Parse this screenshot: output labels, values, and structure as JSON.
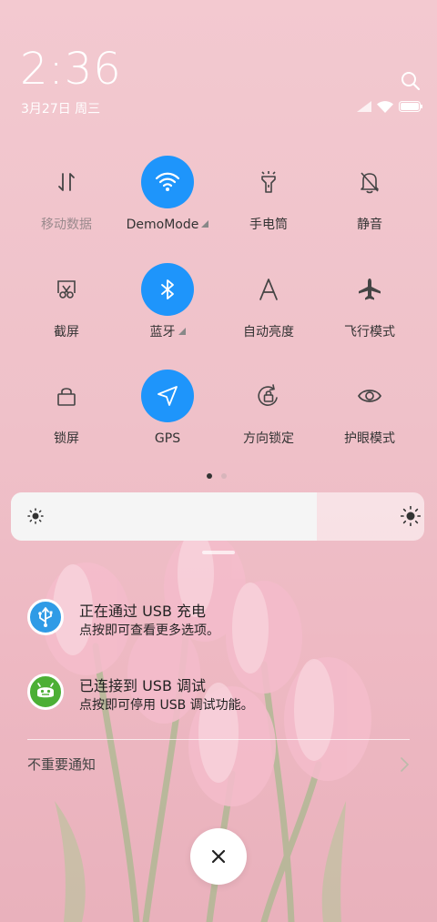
{
  "status": {
    "time": "2:36",
    "date": "3月27日 周三"
  },
  "quick_settings": {
    "row1": [
      {
        "label": "移动数据",
        "icon": "mobile-data-icon",
        "active": false
      },
      {
        "label": "DemoMode",
        "icon": "wifi-icon",
        "active": true
      },
      {
        "label": "手电筒",
        "icon": "flashlight-icon",
        "active": false
      },
      {
        "label": "静音",
        "icon": "mute-bell-icon",
        "active": false
      }
    ],
    "row2": [
      {
        "label": "截屏",
        "icon": "screenshot-icon",
        "active": false
      },
      {
        "label": "蓝牙",
        "icon": "bluetooth-icon",
        "active": true
      },
      {
        "label": "自动亮度",
        "icon": "auto-brightness-icon",
        "active": false
      },
      {
        "label": "飞行模式",
        "icon": "airplane-icon",
        "active": false
      }
    ],
    "row3": [
      {
        "label": "锁屏",
        "icon": "lock-icon",
        "active": false
      },
      {
        "label": "GPS",
        "icon": "gps-icon",
        "active": true
      },
      {
        "label": "方向锁定",
        "icon": "rotation-lock-icon",
        "active": false
      },
      {
        "label": "护眼模式",
        "icon": "eye-icon",
        "active": false
      }
    ],
    "page_count": 2,
    "current_page": 1,
    "accent_color": "#1e95fb"
  },
  "brightness": {
    "level": 0.74
  },
  "notifications": [
    {
      "title": "正在通过 USB 充电",
      "text": "点按即可查看更多选项。",
      "icon": "usb-icon",
      "color": "#2f9be6"
    },
    {
      "title": "已连接到 USB 调试",
      "text": "点按即可停用 USB 调试功能。",
      "icon": "android-icon",
      "color": "#4caf35"
    }
  ],
  "footer": {
    "unimportant_label": "不重要通知"
  }
}
